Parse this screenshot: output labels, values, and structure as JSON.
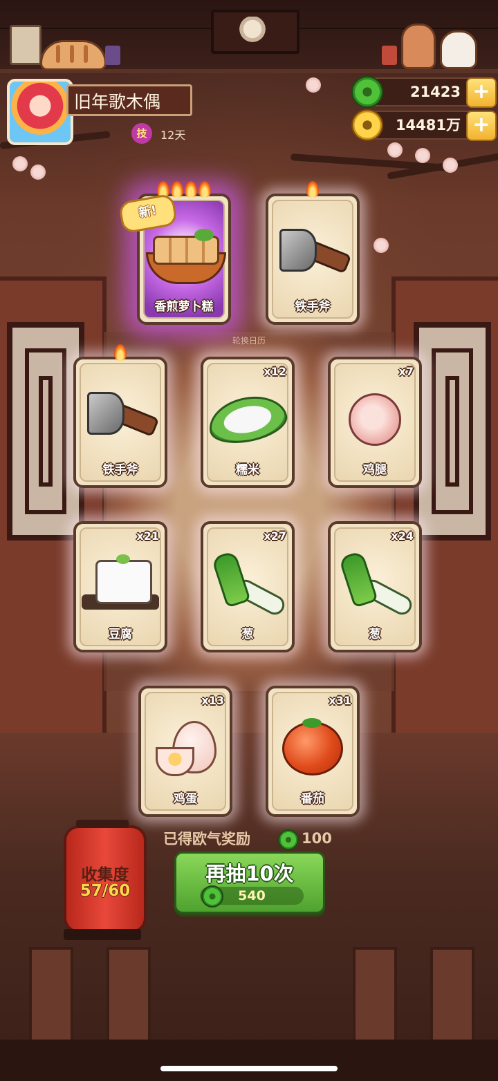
{
  "player": {
    "name": "旧年歌木偶",
    "skill_badge": "技",
    "days": "12天"
  },
  "resources": {
    "jade": "21423",
    "coins": "14481万"
  },
  "scene": {
    "center_label": "轮换日历"
  },
  "cards": [
    {
      "label": "香煎萝卜糕",
      "count": "",
      "flames": 4,
      "is_new": true,
      "new_text": "新!",
      "art": "radish-cake"
    },
    {
      "label": "铁手斧",
      "count": "",
      "flames": 1,
      "is_new": false,
      "art": "iron-hand-axe"
    },
    {
      "label": "铁手斧",
      "count": "",
      "flames": 1,
      "is_new": false,
      "art": "iron-hand-axe"
    },
    {
      "label": "糯米",
      "count": "x12",
      "flames": 0,
      "is_new": false,
      "art": "glutinous-rice"
    },
    {
      "label": "鸡腿",
      "count": "x7",
      "flames": 0,
      "is_new": false,
      "art": "chicken-leg"
    },
    {
      "label": "豆腐",
      "count": "x21",
      "flames": 0,
      "is_new": false,
      "art": "tofu"
    },
    {
      "label": "葱",
      "count": "x27",
      "flames": 0,
      "is_new": false,
      "art": "scallion"
    },
    {
      "label": "葱",
      "count": "x24",
      "flames": 0,
      "is_new": false,
      "art": "scallion"
    },
    {
      "label": "鸡蛋",
      "count": "x13",
      "flames": 0,
      "is_new": false,
      "art": "eggs"
    },
    {
      "label": "番茄",
      "count": "x31",
      "flames": 0,
      "is_new": false,
      "art": "tomato"
    }
  ],
  "reward": {
    "label": "已得欧气奖励",
    "value": "100"
  },
  "collection": {
    "label": "收集度",
    "progress": "57/60"
  },
  "draw_button": {
    "label": "再抽10次",
    "cost": "540"
  },
  "colors": {
    "jade_green": "#4fc23a",
    "button_green": "#6cc04a",
    "lantern_red": "#e8483a",
    "rare_glow": "#c86ae6"
  }
}
